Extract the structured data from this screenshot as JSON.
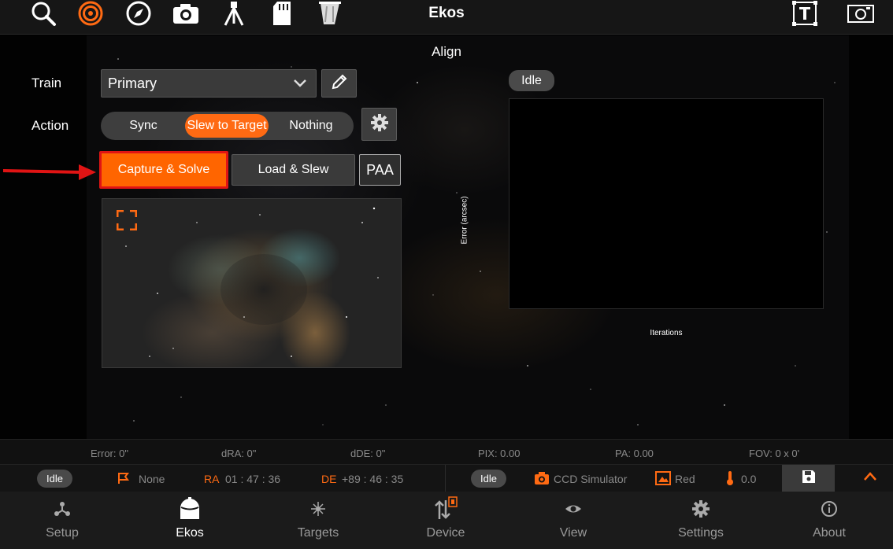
{
  "toolbar": {
    "title": "Ekos",
    "icons": [
      "search-icon",
      "target-icon",
      "compass-icon",
      "camera-icon",
      "tripod-icon",
      "sd-card-icon",
      "trash-icon",
      "text-box-icon",
      "screenshot-icon"
    ]
  },
  "align": {
    "section_title": "Align",
    "train_label": "Train",
    "train_value": "Primary",
    "action_label": "Action",
    "action_options": [
      "Sync",
      "Slew to Target",
      "Nothing"
    ],
    "action_selected": "Slew to Target",
    "capture_solve": "Capture & Solve",
    "load_slew": "Load & Slew",
    "paa": "PAA",
    "status": "Idle",
    "plot_ylabel": "Error (arcsec)",
    "plot_xlabel": "Iterations"
  },
  "stats": {
    "error": "Error: 0\"",
    "dra": "dRA: 0\"",
    "dde": "dDE: 0\"",
    "pix": "PIX: 0.00",
    "pa": "PA: 0.00",
    "fov": "FOV: 0 x 0'"
  },
  "statusbar": {
    "mount_status": "Idle",
    "pier": "None",
    "ra_label": "RA",
    "ra_value": "01 : 47 : 36",
    "de_label": "DE",
    "de_value": "+89 : 46 : 35",
    "camera_status": "Idle",
    "camera": "CCD Simulator",
    "filter": "Red",
    "temperature": "0.0"
  },
  "nav": {
    "items": [
      {
        "label": "Setup",
        "icon": "setup-icon"
      },
      {
        "label": "Ekos",
        "icon": "ekos-icon"
      },
      {
        "label": "Targets",
        "icon": "targets-icon"
      },
      {
        "label": "Device",
        "icon": "device-icon"
      },
      {
        "label": "View",
        "icon": "eye-icon"
      },
      {
        "label": "Settings",
        "icon": "gear-icon"
      },
      {
        "label": "About",
        "icon": "info-icon"
      }
    ],
    "active": "Ekos"
  },
  "colors": {
    "accent": "#ff6a13",
    "highlight": "#e01414",
    "panel": "#3a3a3a"
  }
}
